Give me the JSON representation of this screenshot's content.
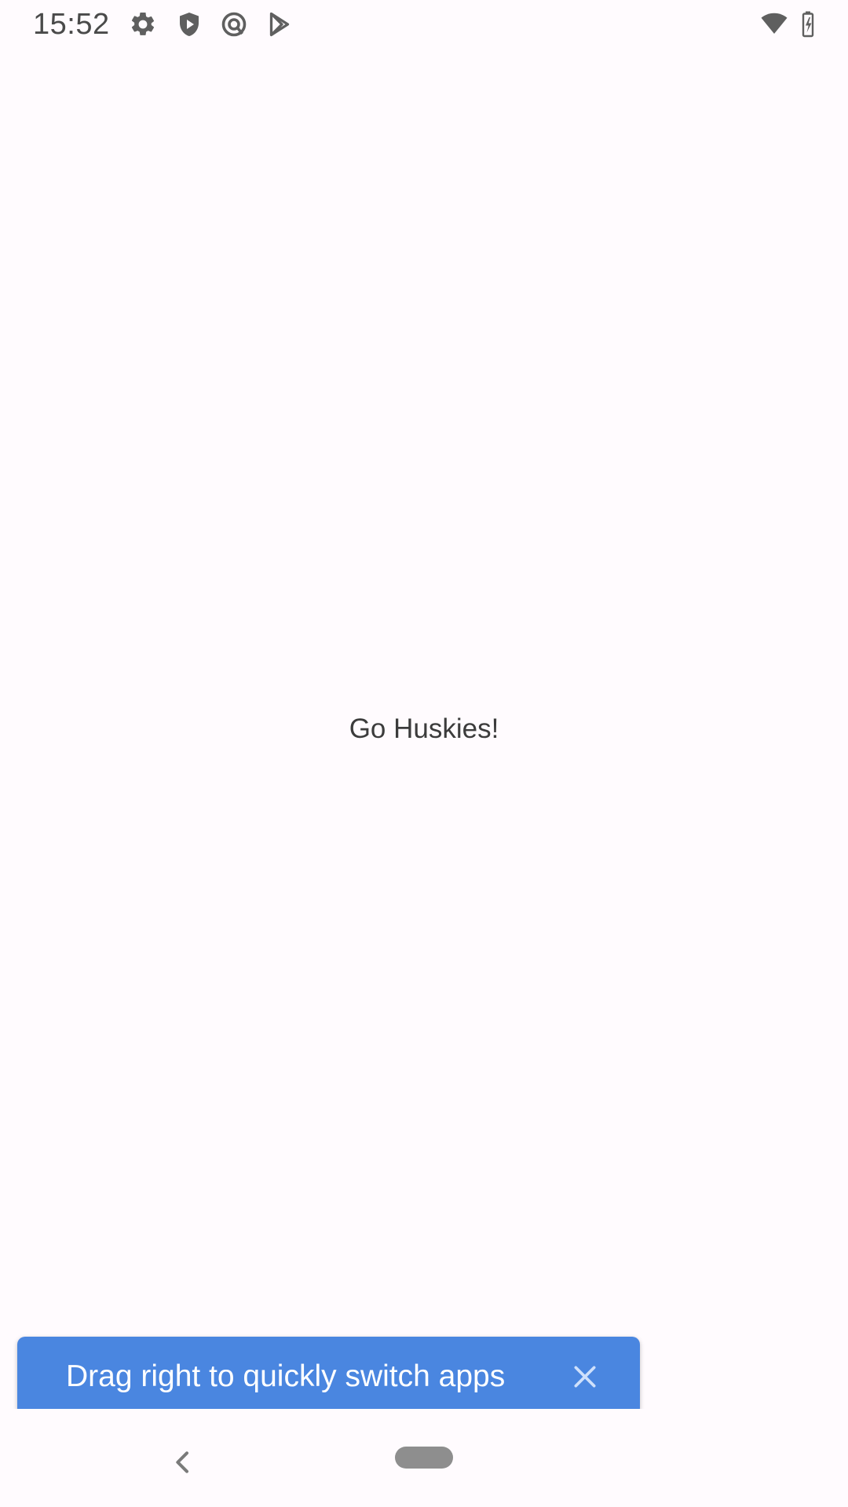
{
  "status_bar": {
    "time": "15:52",
    "icons": [
      "settings-icon",
      "shield-play-icon",
      "at-sign-icon",
      "play-store-icon",
      "wifi-icon",
      "battery-charging-icon"
    ]
  },
  "main": {
    "text": "Go Huskies!"
  },
  "tip": {
    "text": "Drag right to quickly switch apps",
    "close_icon": "close-icon"
  },
  "nav_bar": {
    "back_icon": "back-chevron-icon",
    "home_icon": "home-pill-icon"
  },
  "colors": {
    "background": "#fffbfe",
    "tip_background": "#4a86e0",
    "tip_text": "#ffffff",
    "text": "#3c3c3c",
    "icon": "#5f5f5f"
  }
}
